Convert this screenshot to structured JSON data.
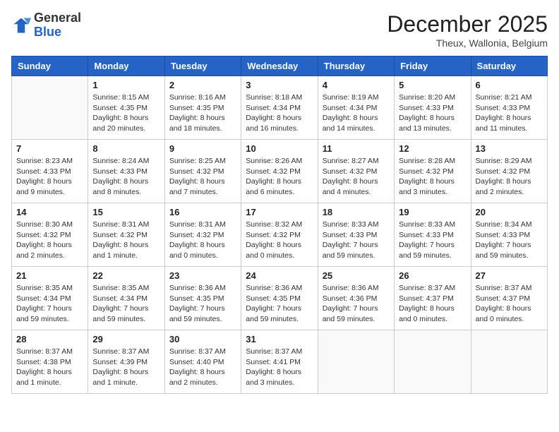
{
  "header": {
    "logo_general": "General",
    "logo_blue": "Blue",
    "month_title": "December 2025",
    "location": "Theux, Wallonia, Belgium"
  },
  "days_of_week": [
    "Sunday",
    "Monday",
    "Tuesday",
    "Wednesday",
    "Thursday",
    "Friday",
    "Saturday"
  ],
  "weeks": [
    [
      {
        "day": "",
        "info": ""
      },
      {
        "day": "1",
        "info": "Sunrise: 8:15 AM\nSunset: 4:35 PM\nDaylight: 8 hours\nand 20 minutes."
      },
      {
        "day": "2",
        "info": "Sunrise: 8:16 AM\nSunset: 4:35 PM\nDaylight: 8 hours\nand 18 minutes."
      },
      {
        "day": "3",
        "info": "Sunrise: 8:18 AM\nSunset: 4:34 PM\nDaylight: 8 hours\nand 16 minutes."
      },
      {
        "day": "4",
        "info": "Sunrise: 8:19 AM\nSunset: 4:34 PM\nDaylight: 8 hours\nand 14 minutes."
      },
      {
        "day": "5",
        "info": "Sunrise: 8:20 AM\nSunset: 4:33 PM\nDaylight: 8 hours\nand 13 minutes."
      },
      {
        "day": "6",
        "info": "Sunrise: 8:21 AM\nSunset: 4:33 PM\nDaylight: 8 hours\nand 11 minutes."
      }
    ],
    [
      {
        "day": "7",
        "info": "Sunrise: 8:23 AM\nSunset: 4:33 PM\nDaylight: 8 hours\nand 9 minutes."
      },
      {
        "day": "8",
        "info": "Sunrise: 8:24 AM\nSunset: 4:33 PM\nDaylight: 8 hours\nand 8 minutes."
      },
      {
        "day": "9",
        "info": "Sunrise: 8:25 AM\nSunset: 4:32 PM\nDaylight: 8 hours\nand 7 minutes."
      },
      {
        "day": "10",
        "info": "Sunrise: 8:26 AM\nSunset: 4:32 PM\nDaylight: 8 hours\nand 6 minutes."
      },
      {
        "day": "11",
        "info": "Sunrise: 8:27 AM\nSunset: 4:32 PM\nDaylight: 8 hours\nand 4 minutes."
      },
      {
        "day": "12",
        "info": "Sunrise: 8:28 AM\nSunset: 4:32 PM\nDaylight: 8 hours\nand 3 minutes."
      },
      {
        "day": "13",
        "info": "Sunrise: 8:29 AM\nSunset: 4:32 PM\nDaylight: 8 hours\nand 2 minutes."
      }
    ],
    [
      {
        "day": "14",
        "info": "Sunrise: 8:30 AM\nSunset: 4:32 PM\nDaylight: 8 hours\nand 2 minutes."
      },
      {
        "day": "15",
        "info": "Sunrise: 8:31 AM\nSunset: 4:32 PM\nDaylight: 8 hours\nand 1 minute."
      },
      {
        "day": "16",
        "info": "Sunrise: 8:31 AM\nSunset: 4:32 PM\nDaylight: 8 hours\nand 0 minutes."
      },
      {
        "day": "17",
        "info": "Sunrise: 8:32 AM\nSunset: 4:32 PM\nDaylight: 8 hours\nand 0 minutes."
      },
      {
        "day": "18",
        "info": "Sunrise: 8:33 AM\nSunset: 4:33 PM\nDaylight: 7 hours\nand 59 minutes."
      },
      {
        "day": "19",
        "info": "Sunrise: 8:33 AM\nSunset: 4:33 PM\nDaylight: 7 hours\nand 59 minutes."
      },
      {
        "day": "20",
        "info": "Sunrise: 8:34 AM\nSunset: 4:33 PM\nDaylight: 7 hours\nand 59 minutes."
      }
    ],
    [
      {
        "day": "21",
        "info": "Sunrise: 8:35 AM\nSunset: 4:34 PM\nDaylight: 7 hours\nand 59 minutes."
      },
      {
        "day": "22",
        "info": "Sunrise: 8:35 AM\nSunset: 4:34 PM\nDaylight: 7 hours\nand 59 minutes."
      },
      {
        "day": "23",
        "info": "Sunrise: 8:36 AM\nSunset: 4:35 PM\nDaylight: 7 hours\nand 59 minutes."
      },
      {
        "day": "24",
        "info": "Sunrise: 8:36 AM\nSunset: 4:35 PM\nDaylight: 7 hours\nand 59 minutes."
      },
      {
        "day": "25",
        "info": "Sunrise: 8:36 AM\nSunset: 4:36 PM\nDaylight: 7 hours\nand 59 minutes."
      },
      {
        "day": "26",
        "info": "Sunrise: 8:37 AM\nSunset: 4:37 PM\nDaylight: 8 hours\nand 0 minutes."
      },
      {
        "day": "27",
        "info": "Sunrise: 8:37 AM\nSunset: 4:37 PM\nDaylight: 8 hours\nand 0 minutes."
      }
    ],
    [
      {
        "day": "28",
        "info": "Sunrise: 8:37 AM\nSunset: 4:38 PM\nDaylight: 8 hours\nand 1 minute."
      },
      {
        "day": "29",
        "info": "Sunrise: 8:37 AM\nSunset: 4:39 PM\nDaylight: 8 hours\nand 1 minute."
      },
      {
        "day": "30",
        "info": "Sunrise: 8:37 AM\nSunset: 4:40 PM\nDaylight: 8 hours\nand 2 minutes."
      },
      {
        "day": "31",
        "info": "Sunrise: 8:37 AM\nSunset: 4:41 PM\nDaylight: 8 hours\nand 3 minutes."
      },
      {
        "day": "",
        "info": ""
      },
      {
        "day": "",
        "info": ""
      },
      {
        "day": "",
        "info": ""
      }
    ]
  ]
}
